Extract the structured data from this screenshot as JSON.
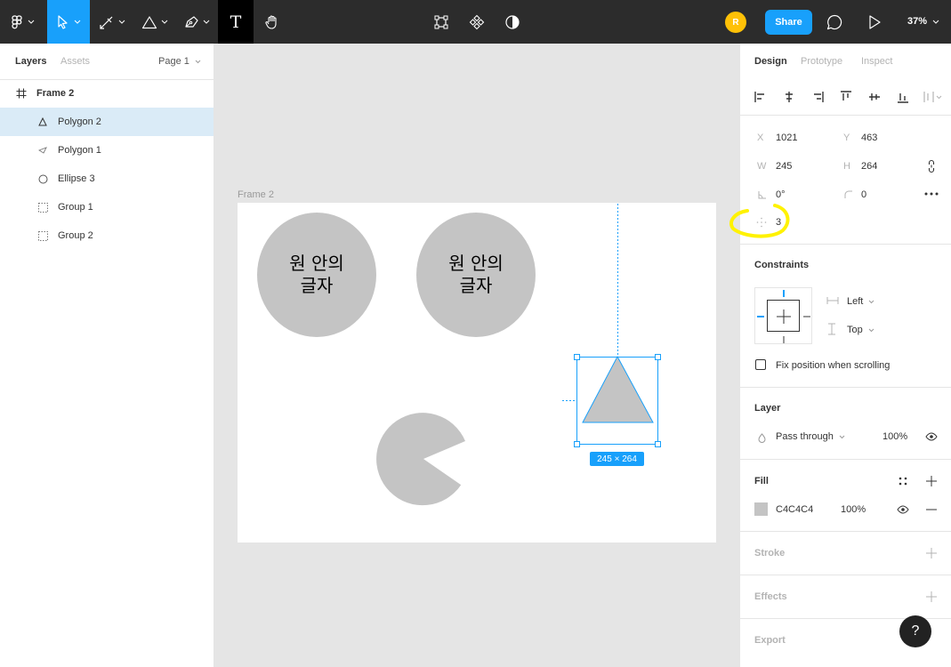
{
  "toolbar": {
    "zoom": "37%",
    "share_label": "Share",
    "avatar_initial": "R",
    "text_tool_glyph": "T"
  },
  "left_panel": {
    "tabs": {
      "layers": "Layers",
      "assets": "Assets"
    },
    "page": "Page 1",
    "layers": [
      {
        "name": "Frame 2",
        "icon": "frame-icon",
        "selected": false
      },
      {
        "name": "Polygon 2",
        "icon": "triangle-icon",
        "selected": true
      },
      {
        "name": "Polygon 1",
        "icon": "small-triangle-icon",
        "selected": false
      },
      {
        "name": "Ellipse 3",
        "icon": "ellipse-icon",
        "selected": false
      },
      {
        "name": "Group 1",
        "icon": "group-icon",
        "selected": false
      },
      {
        "name": "Group 2",
        "icon": "group-icon",
        "selected": false
      }
    ]
  },
  "canvas": {
    "frame_label": "Frame 2",
    "circle_1_text": {
      "line1": "원 안의",
      "line2": "글자"
    },
    "circle_2_text": {
      "line1": "원 안의",
      "line2": "글자"
    },
    "selection_size": "245 × 264",
    "shape_fill": "#C4C4C4",
    "selection_color": "#18A0FB"
  },
  "right_panel": {
    "tabs": {
      "design": "Design",
      "prototype": "Prototype",
      "inspect": "Inspect"
    },
    "transform": {
      "x_label": "X",
      "x": "1021",
      "y_label": "Y",
      "y": "463",
      "w_label": "W",
      "w": "245",
      "h_label": "H",
      "h": "264",
      "rotation": "0°",
      "radius": "0",
      "count": "3"
    },
    "constraints": {
      "title": "Constraints",
      "horizontal": "Left",
      "vertical": "Top",
      "fix_position": "Fix position when scrolling"
    },
    "layer": {
      "title": "Layer",
      "blend": "Pass through",
      "opacity": "100%"
    },
    "fill": {
      "title": "Fill",
      "hex": "C4C4C4",
      "opacity": "100%"
    },
    "stroke_title": "Stroke",
    "effects_title": "Effects",
    "export_title": "Export",
    "help": "?"
  },
  "highlight_color": "#FFF200"
}
